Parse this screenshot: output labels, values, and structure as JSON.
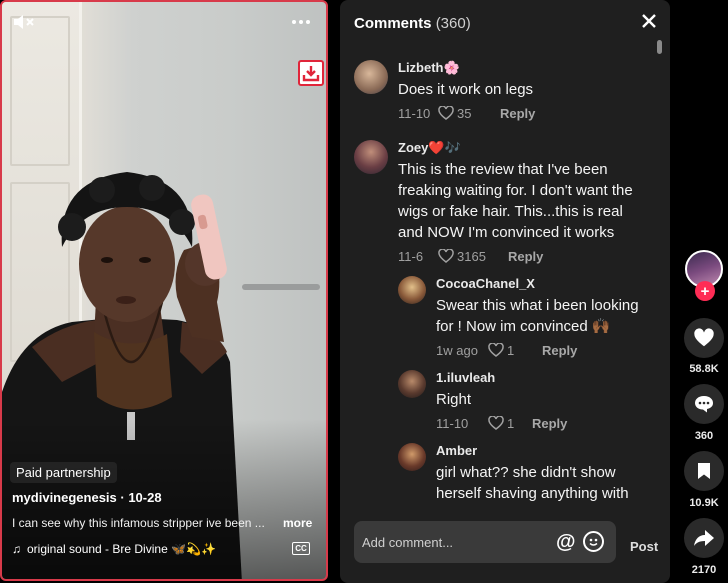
{
  "video": {
    "paid_label": "Paid partnership",
    "author": "mydivinegenesis · 10-28",
    "caption": "I can see why this infamous stripper ive been ...",
    "more_label": "more",
    "sound": "original sound - Bre Divine 🦋💫✨",
    "cc_label": "CC"
  },
  "comments": {
    "title": "Comments",
    "count": "(360)",
    "items": [
      {
        "user": "Lizbeth🌸",
        "text": "Does it work on legs",
        "date": "11-10",
        "likes": "35",
        "reply": "Reply"
      },
      {
        "user": "Zoey❤️🎶",
        "text": "This is the review that I've been freaking waiting for. I don't want the wigs or fake hair. This...this is real and NOW I'm convinced it works",
        "date": "11-6",
        "likes": "3165",
        "reply": "Reply"
      },
      {
        "user": "CocoaChanel_X",
        "text": "Swear this what i been looking for ! Now im convinced 🙌🏾",
        "date": "1w ago",
        "likes": "1",
        "reply": "Reply"
      },
      {
        "user": "1.iluvleah",
        "text": "Right",
        "date": "11-10",
        "likes": "1",
        "reply": "Reply"
      },
      {
        "user": "Amber",
        "text": "girl what?? she didn't show herself shaving anything with",
        "date": "",
        "likes": "",
        "reply": ""
      }
    ],
    "input_placeholder": "Add comment...",
    "post_label": "Post"
  },
  "actions": {
    "likes": "58.8K",
    "comments": "360",
    "saves": "10.9K",
    "shares": "2170"
  },
  "colors": {
    "accent": "#fe2c55",
    "panel_bg": "#1f1f1f",
    "border_red": "#d83a4a"
  }
}
